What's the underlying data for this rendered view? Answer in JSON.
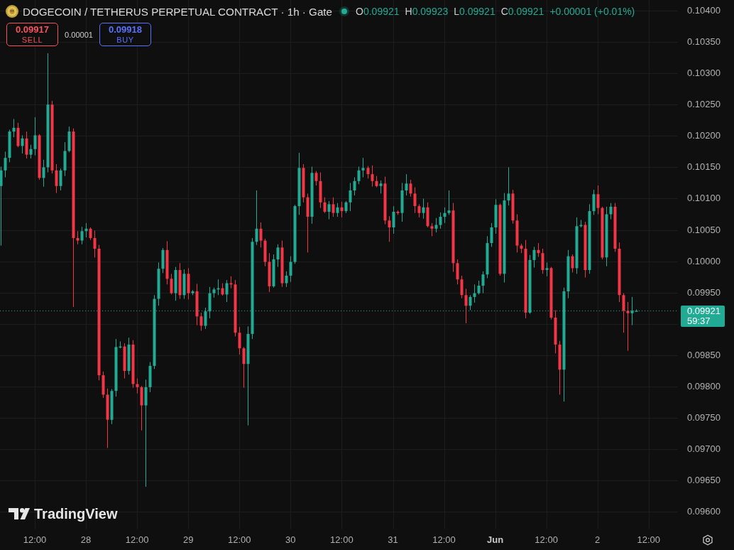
{
  "legend": {
    "title": "DOGECOIN / TETHERUS PERPETUAL CONTRACT · 1h · Gate",
    "ohlc": [
      {
        "label": "O",
        "value": "0.09921"
      },
      {
        "label": "H",
        "value": "0.09923"
      },
      {
        "label": "L",
        "value": "0.09921"
      },
      {
        "label": "C",
        "value": "0.09921"
      }
    ],
    "change": "+0.00001 (+0.01%)"
  },
  "order_panel": [
    {
      "kind": "sell",
      "price": "0.09917",
      "label": "SELL"
    },
    {
      "kind": "spread",
      "value": "0.00001"
    },
    {
      "kind": "buy",
      "price": "0.09918",
      "label": "BUY"
    }
  ],
  "chart": {
    "chart_data": {
      "type": "candlestick",
      "grid": true,
      "categories": [
        null,
        null,
        null,
        null,
        null,
        null,
        null,
        null,
        "12:00",
        null,
        null,
        null,
        null,
        null,
        null,
        null,
        null,
        null,
        null,
        null,
        "28",
        null,
        null,
        null,
        null,
        null,
        null,
        null,
        null,
        null,
        null,
        null,
        "12:00",
        null,
        null,
        null,
        null,
        null,
        null,
        null,
        null,
        null,
        null,
        null,
        "29",
        null,
        null,
        null,
        null,
        null,
        null,
        null,
        null,
        null,
        null,
        null,
        "12:00",
        null,
        null,
        null,
        null,
        null,
        null,
        null,
        null,
        null,
        null,
        null,
        "30",
        null,
        null,
        null,
        null,
        null,
        null,
        null,
        null,
        null,
        null,
        null,
        "12:00",
        null,
        null,
        null,
        null,
        null,
        null,
        null,
        null,
        null,
        null,
        null,
        "31",
        null,
        null,
        null,
        null,
        null,
        null,
        null,
        null,
        null,
        null,
        null,
        "12:00",
        null,
        null,
        null,
        null,
        null,
        null,
        null,
        null,
        null,
        null,
        null,
        "Jun",
        null,
        null,
        null,
        null,
        null,
        null,
        null,
        null,
        null,
        null,
        null,
        "12:00",
        null,
        null,
        null,
        null,
        null,
        null,
        null,
        null,
        null,
        null,
        null,
        "2",
        null,
        null,
        null,
        null,
        null,
        null,
        null,
        null,
        null,
        null,
        null,
        "12:00",
        null,
        null,
        null,
        null,
        null,
        null
      ],
      "ohlc": [
        [
          0.1012,
          0.10151,
          0.10025,
          0.10145
        ],
        [
          0.10145,
          0.10175,
          0.10134,
          0.10165
        ],
        [
          0.10165,
          0.1021,
          0.10158,
          0.10207
        ],
        [
          0.10207,
          0.10227,
          0.10198,
          0.10213
        ],
        [
          0.10213,
          0.10221,
          0.10182,
          0.10184
        ],
        [
          0.10184,
          0.10201,
          0.10172,
          0.10196
        ],
        [
          0.10196,
          0.10207,
          0.10164,
          0.1017
        ],
        [
          0.1017,
          0.10186,
          0.10164,
          0.10179
        ],
        [
          0.10179,
          0.1023,
          0.10169,
          0.10201
        ],
        [
          0.10201,
          0.10203,
          0.1013,
          0.10133
        ],
        [
          0.10133,
          0.10162,
          0.10119,
          0.1015
        ],
        [
          0.1015,
          0.10332,
          0.10142,
          0.1025
        ],
        [
          0.1025,
          0.10256,
          0.1014,
          0.10145
        ],
        [
          0.10145,
          0.10155,
          0.10109,
          0.1012
        ],
        [
          0.1012,
          0.10148,
          0.10113,
          0.10145
        ],
        [
          0.10145,
          0.1019,
          0.10136,
          0.10176
        ],
        [
          0.10176,
          0.10215,
          0.10174,
          0.10207
        ],
        [
          0.10207,
          0.10212,
          0.09927,
          0.10037
        ],
        [
          0.10037,
          0.10048,
          0.10027,
          0.10033
        ],
        [
          0.10033,
          0.10055,
          0.10027,
          0.10048
        ],
        [
          0.10048,
          0.10061,
          0.10038,
          0.10052
        ],
        [
          0.10052,
          0.10054,
          0.10034,
          0.10037
        ],
        [
          0.10037,
          0.10049,
          0.10006,
          0.1002
        ],
        [
          0.1002,
          0.10026,
          0.0981,
          0.09818
        ],
        [
          0.09818,
          0.09824,
          0.09782,
          0.09787
        ],
        [
          0.09787,
          0.09797,
          0.09702,
          0.09747
        ],
        [
          0.09747,
          0.09796,
          0.0974,
          0.09793
        ],
        [
          0.09793,
          0.09876,
          0.09784,
          0.09863
        ],
        [
          0.09863,
          0.09872,
          0.09861,
          0.09864
        ],
        [
          0.09864,
          0.09869,
          0.09813,
          0.09825
        ],
        [
          0.09825,
          0.09878,
          0.09819,
          0.09867
        ],
        [
          0.09867,
          0.09874,
          0.09798,
          0.09804
        ],
        [
          0.09804,
          0.09813,
          0.09789,
          0.09799
        ],
        [
          0.09799,
          0.09801,
          0.0973,
          0.0977
        ],
        [
          0.0977,
          0.09811,
          0.0964,
          0.09799
        ],
        [
          0.09799,
          0.09839,
          0.09791,
          0.09833
        ],
        [
          0.09833,
          0.09946,
          0.09828,
          0.0994
        ],
        [
          0.0994,
          0.09998,
          0.09929,
          0.09988
        ],
        [
          0.09988,
          0.10021,
          0.09981,
          0.10018
        ],
        [
          0.10018,
          0.10032,
          0.09963,
          0.09972
        ],
        [
          0.09972,
          0.0998,
          0.09947,
          0.09949
        ],
        [
          0.09949,
          0.09991,
          0.09937,
          0.09986
        ],
        [
          0.09986,
          0.09997,
          0.0994,
          0.09946
        ],
        [
          0.09946,
          0.09987,
          0.0994,
          0.0998
        ],
        [
          0.0998,
          0.09989,
          0.09939,
          0.09949
        ],
        [
          0.09949,
          0.09954,
          0.09946,
          0.09952
        ],
        [
          0.09952,
          0.09964,
          0.09898,
          0.09912
        ],
        [
          0.09912,
          0.09918,
          0.09889,
          0.09897
        ],
        [
          0.09897,
          0.09926,
          0.09892,
          0.0992
        ],
        [
          0.0992,
          0.09959,
          0.09909,
          0.09949
        ],
        [
          0.09949,
          0.09958,
          0.09942,
          0.09955
        ],
        [
          0.09955,
          0.09971,
          0.09946,
          0.09957
        ],
        [
          0.09957,
          0.09965,
          0.09945,
          0.09947
        ],
        [
          0.09947,
          0.0997,
          0.09935,
          0.09965
        ],
        [
          0.09965,
          0.09976,
          0.09957,
          0.09963
        ],
        [
          0.09963,
          0.0997,
          0.0988,
          0.09886
        ],
        [
          0.09886,
          0.09895,
          0.09851,
          0.09861
        ],
        [
          0.09861,
          0.09863,
          0.09798,
          0.09836
        ],
        [
          0.09836,
          0.09896,
          0.09738,
          0.09884
        ],
        [
          0.09884,
          0.10037,
          0.09876,
          0.10031
        ],
        [
          0.10031,
          0.10113,
          0.10026,
          0.10052
        ],
        [
          0.10052,
          0.10062,
          0.10022,
          0.10033
        ],
        [
          0.10033,
          0.10036,
          0.09992,
          0.09999
        ],
        [
          0.09999,
          0.10013,
          0.09951,
          0.0996
        ],
        [
          0.0996,
          0.10011,
          0.09958,
          0.10003
        ],
        [
          0.10003,
          0.10027,
          0.09991,
          0.10022
        ],
        [
          0.10022,
          0.10033,
          0.09959,
          0.09965
        ],
        [
          0.09965,
          0.09984,
          0.09959,
          0.09977
        ],
        [
          0.09977,
          0.10008,
          0.09967,
          0.09999
        ],
        [
          0.09999,
          0.1009,
          0.09996,
          0.10088
        ],
        [
          0.10088,
          0.10173,
          0.10074,
          0.10149
        ],
        [
          0.10149,
          0.10155,
          0.10094,
          0.10102
        ],
        [
          0.10102,
          0.10108,
          0.10014,
          0.10071
        ],
        [
          0.10071,
          0.10151,
          0.1006,
          0.10141
        ],
        [
          0.10141,
          0.10144,
          0.10121,
          0.10128
        ],
        [
          0.10128,
          0.10142,
          0.10085,
          0.10094
        ],
        [
          0.10094,
          0.10102,
          0.10077,
          0.10079
        ],
        [
          0.10079,
          0.10096,
          0.10067,
          0.10091
        ],
        [
          0.10091,
          0.10102,
          0.10071,
          0.10077
        ],
        [
          0.10077,
          0.10093,
          0.10071,
          0.10086
        ],
        [
          0.10086,
          0.10095,
          0.1007,
          0.1008
        ],
        [
          0.1008,
          0.10096,
          0.10077,
          0.10094
        ],
        [
          0.10094,
          0.10125,
          0.1008,
          0.10113
        ],
        [
          0.10113,
          0.10134,
          0.10105,
          0.10128
        ],
        [
          0.10128,
          0.10151,
          0.10123,
          0.10145
        ],
        [
          0.10145,
          0.10165,
          0.10134,
          0.10149
        ],
        [
          0.10149,
          0.10152,
          0.10132,
          0.10139
        ],
        [
          0.10139,
          0.10153,
          0.10119,
          0.10128
        ],
        [
          0.10128,
          0.10136,
          0.10118,
          0.1012
        ],
        [
          0.1012,
          0.10129,
          0.10108,
          0.10124
        ],
        [
          0.10124,
          0.10135,
          0.10059,
          0.10065
        ],
        [
          0.10065,
          0.10072,
          0.10031,
          0.10054
        ],
        [
          0.10054,
          0.10088,
          0.10044,
          0.10079
        ],
        [
          0.10079,
          0.10081,
          0.10074,
          0.10077
        ],
        [
          0.10077,
          0.10125,
          0.10063,
          0.10113
        ],
        [
          0.10113,
          0.10139,
          0.10105,
          0.10124
        ],
        [
          0.10124,
          0.1013,
          0.10103,
          0.10108
        ],
        [
          0.10108,
          0.10118,
          0.10077,
          0.10088
        ],
        [
          0.10088,
          0.10091,
          0.1007,
          0.10077
        ],
        [
          0.10077,
          0.101,
          0.10068,
          0.10086
        ],
        [
          0.10086,
          0.10094,
          0.10054,
          0.10056
        ],
        [
          0.10056,
          0.10061,
          0.1004,
          0.10052
        ],
        [
          0.10052,
          0.10069,
          0.10046,
          0.10058
        ],
        [
          0.10058,
          0.10078,
          0.10052,
          0.10071
        ],
        [
          0.10071,
          0.10086,
          0.10061,
          0.10077
        ],
        [
          0.10077,
          0.10113,
          0.10074,
          0.10081
        ],
        [
          0.10081,
          0.10093,
          0.09983,
          0.09997
        ],
        [
          0.09997,
          0.10003,
          0.09963,
          0.09971
        ],
        [
          0.09971,
          0.09977,
          0.09941,
          0.09946
        ],
        [
          0.09946,
          0.09956,
          0.09901,
          0.09929
        ],
        [
          0.09929,
          0.09946,
          0.09922,
          0.09943
        ],
        [
          0.09943,
          0.09963,
          0.09934,
          0.09949
        ],
        [
          0.09949,
          0.09969,
          0.09947,
          0.09961
        ],
        [
          0.09961,
          0.09984,
          0.09949,
          0.09979
        ],
        [
          0.09979,
          0.1004,
          0.09973,
          0.10029
        ],
        [
          0.10029,
          0.10061,
          0.10023,
          0.10054
        ],
        [
          0.10054,
          0.10099,
          0.10044,
          0.1009
        ],
        [
          0.1009,
          0.10092,
          0.09977,
          0.0998
        ],
        [
          0.0998,
          0.10109,
          0.09966,
          0.10097
        ],
        [
          0.10097,
          0.1015,
          0.10089,
          0.10108
        ],
        [
          0.10108,
          0.10114,
          0.1006,
          0.10065
        ],
        [
          0.10065,
          0.10075,
          0.10014,
          0.10025
        ],
        [
          0.10025,
          0.10028,
          0.10013,
          0.1002
        ],
        [
          0.1002,
          0.10034,
          0.09909,
          0.09918
        ],
        [
          0.09918,
          0.1001,
          0.09916,
          0.10002
        ],
        [
          0.10002,
          0.10023,
          0.0999,
          0.10018
        ],
        [
          0.10018,
          0.10029,
          0.10007,
          0.10013
        ],
        [
          0.10013,
          0.1002,
          0.0998,
          0.09986
        ],
        [
          0.09986,
          0.09998,
          0.09976,
          0.09989
        ],
        [
          0.09989,
          0.09991,
          0.09907,
          0.0991
        ],
        [
          0.0991,
          0.09922,
          0.09853,
          0.09867
        ],
        [
          0.09867,
          0.09873,
          0.09787,
          0.09827
        ],
        [
          0.09827,
          0.09958,
          0.09776,
          0.09952
        ],
        [
          0.09952,
          0.10018,
          0.09941,
          0.10008
        ],
        [
          0.10008,
          0.10011,
          0.09982,
          0.09989
        ],
        [
          0.09989,
          0.1007,
          0.0998,
          0.10056
        ],
        [
          0.10056,
          0.10066,
          0.10054,
          0.10058
        ],
        [
          0.10058,
          0.10063,
          0.09974,
          0.09986
        ],
        [
          0.09986,
          0.10091,
          0.0998,
          0.1008
        ],
        [
          0.1008,
          0.10114,
          0.10074,
          0.10107
        ],
        [
          0.10107,
          0.10121,
          0.10075,
          0.10085
        ],
        [
          0.10085,
          0.10087,
          0.10003,
          0.10006
        ],
        [
          0.10006,
          0.10087,
          0.09992,
          0.10075
        ],
        [
          0.10075,
          0.10093,
          0.10067,
          0.10087
        ],
        [
          0.10087,
          0.10093,
          0.10015,
          0.1002
        ],
        [
          0.1002,
          0.1003,
          0.09935,
          0.09946
        ],
        [
          0.09946,
          0.09949,
          0.09886,
          0.09921
        ],
        [
          0.09921,
          0.09935,
          0.09857,
          0.09917
        ],
        [
          0.09917,
          0.09943,
          0.09898,
          0.09921
        ],
        [
          0.09921,
          0.09923,
          0.09921,
          0.09921
        ],
        null,
        null,
        null,
        null,
        null,
        null,
        null,
        null,
        null
      ],
      "ylim": [
        0.09572,
        0.10417
      ],
      "yticks": [
        {
          "value": 0.104,
          "label": "0.10400"
        },
        {
          "value": 0.1035,
          "label": "0.10350"
        },
        {
          "value": 0.103,
          "label": "0.10300"
        },
        {
          "value": 0.1025,
          "label": "0.10250"
        },
        {
          "value": 0.102,
          "label": "0.10200"
        },
        {
          "value": 0.1015,
          "label": "0.10150"
        },
        {
          "value": 0.101,
          "label": "0.10100"
        },
        {
          "value": 0.1005,
          "label": "0.10050"
        },
        {
          "value": 0.1,
          "label": "0.10000"
        },
        {
          "value": 0.0995,
          "label": "0.09950"
        },
        {
          "value": 0.0985,
          "label": "0.09850"
        },
        {
          "value": 0.098,
          "label": "0.09800"
        },
        {
          "value": 0.0975,
          "label": "0.09750"
        },
        {
          "value": 0.097,
          "label": "0.09700"
        },
        {
          "value": 0.0965,
          "label": "0.09650"
        },
        {
          "value": 0.096,
          "label": "0.09600"
        }
      ],
      "ref_lines": [
        {
          "axis": "y",
          "value": 0.09921,
          "label": "0.09921"
        }
      ]
    },
    "time_axis_ticks": [
      {
        "emphasized": false
      },
      {
        "emphasized": false
      },
      {
        "emphasized": false
      },
      {
        "emphasized": false
      },
      {
        "emphasized": false
      },
      {
        "emphasized": false
      },
      {
        "emphasized": false
      },
      {
        "emphasized": false
      },
      {
        "emphasized": false
      },
      {
        "emphasized": true
      },
      {
        "emphasized": false
      },
      {
        "emphasized": false
      },
      {
        "emphasized": false
      }
    ],
    "last_price": {
      "countdown": "59:37"
    }
  },
  "logo": "TradingView"
}
